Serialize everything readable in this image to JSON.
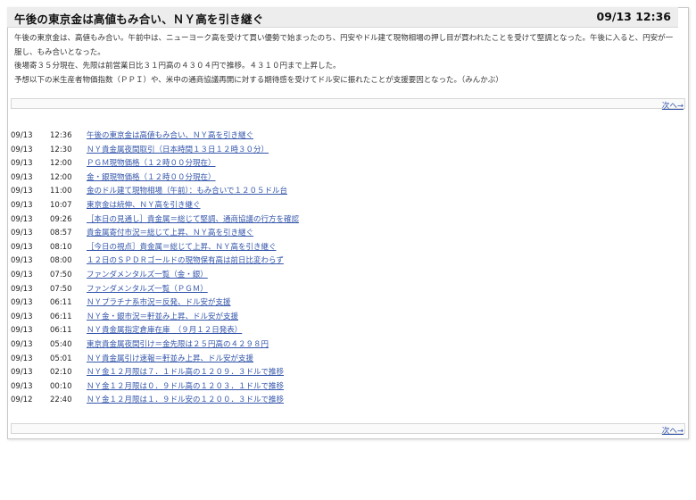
{
  "header": {
    "title": "午後の東京金は高値もみ合い、ＮＹ高を引き継ぐ",
    "datetime": "09/13 12:36"
  },
  "article": {
    "paragraphs": [
      "午後の東京金は、高値もみ合い。午前中は、ニューヨーク高を受けて買い優勢で始まったのち、円安やドル建て現物相場の押し目が買われたことを受けて堅調となった。午後に入ると、円安が一服し、もみ合いとなった。",
      "後場寄３５分現在、先限は前営業日比３１円高の４３０４円で推移。４３１０円まで上昇した。",
      "予想以下の米生産者物価指数（ＰＰＩ）や、米中の通商協議再開に対する期待感を受けてドル安に振れたことが支援要因となった。（みんかぶ）"
    ]
  },
  "nav": {
    "next_label_top": "次へ→",
    "next_label_bottom": "次へ→"
  },
  "news": [
    {
      "date": "09/13",
      "time": "12:36",
      "title": "午後の東京金は高値もみ合い、ＮＹ高を引き継ぐ"
    },
    {
      "date": "09/13",
      "time": "12:30",
      "title": "ＮＹ貴金属夜間取引（日本時間１３日１２時３０分）"
    },
    {
      "date": "09/13",
      "time": "12:00",
      "title": "ＰＧＭ現物価格（１２時００分現在）"
    },
    {
      "date": "09/13",
      "time": "12:00",
      "title": "金・銀現物価格（１２時００分現在）"
    },
    {
      "date": "09/13",
      "time": "11:00",
      "title": "金のドル建て現物相場（午前）：もみ合いで１２０５ドル台"
    },
    {
      "date": "09/13",
      "time": "10:07",
      "title": "東京金は続伸、ＮＹ高を引き継ぐ"
    },
    {
      "date": "09/13",
      "time": "09:26",
      "title": "［本日の見通し］貴金属＝総じて堅調、通商協議の行方を確認"
    },
    {
      "date": "09/13",
      "time": "08:57",
      "title": "貴金属寄付市況＝総じて上昇、ＮＹ高を引き継ぐ"
    },
    {
      "date": "09/13",
      "time": "08:10",
      "title": "［今日の視点］貴金属＝総じて上昇、ＮＹ高を引き継ぐ"
    },
    {
      "date": "09/13",
      "time": "08:00",
      "title": "１２日のＳＰＤＲゴールドの現物保有高は前日比変わらず"
    },
    {
      "date": "09/13",
      "time": "07:50",
      "title": "ファンダメンタルズ一覧（金・銀）"
    },
    {
      "date": "09/13",
      "time": "07:50",
      "title": "ファンダメンタルズ一覧（ＰＧＭ）"
    },
    {
      "date": "09/13",
      "time": "06:11",
      "title": "ＮＹプラチナ系市況＝反発、ドル安が支援"
    },
    {
      "date": "09/13",
      "time": "06:11",
      "title": "ＮＹ金・銀市況＝軒並み上昇、ドル安が支援"
    },
    {
      "date": "09/13",
      "time": "06:11",
      "title": "ＮＹ貴金属指定倉庫在庫　（９月１２日発表）"
    },
    {
      "date": "09/13",
      "time": "05:40",
      "title": "東京貴金属夜間引け＝金先限は２５円高の４２９８円"
    },
    {
      "date": "09/13",
      "time": "05:01",
      "title": "ＮＹ貴金属引け速報＝軒並み上昇、ドル安が支援"
    },
    {
      "date": "09/13",
      "time": "02:10",
      "title": "ＮＹ金１２月限は７．１ドル高の１２０９．３ドルで推移"
    },
    {
      "date": "09/13",
      "time": "00:10",
      "title": "ＮＹ金１２月限は０．９ドル高の１２０３．１ドルで推移"
    },
    {
      "date": "09/12",
      "time": "22:40",
      "title": "ＮＹ金１２月限は１．９ドル安の１２００．３ドルで推移"
    }
  ]
}
